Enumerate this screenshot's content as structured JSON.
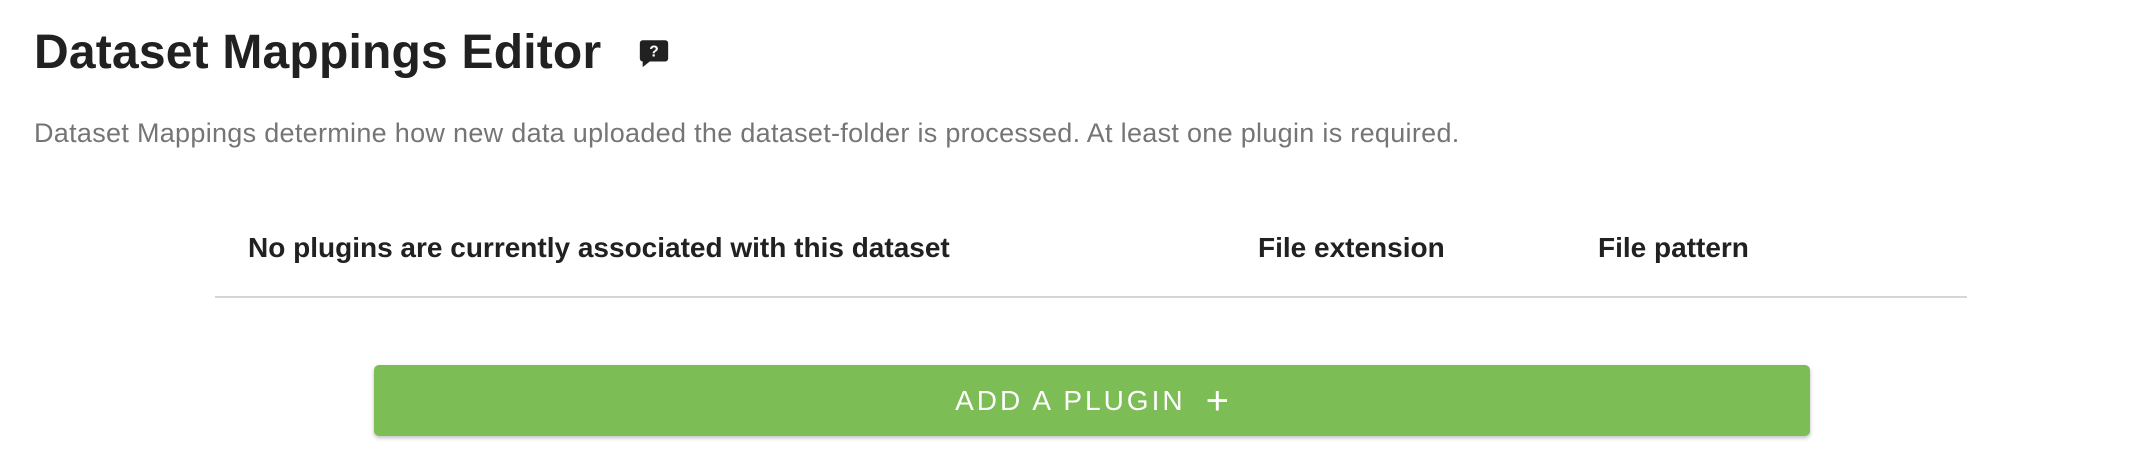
{
  "header": {
    "title": "Dataset Mappings Editor",
    "help_icon": "help-comment-icon"
  },
  "description": "Dataset Mappings determine how new data uploaded the dataset-folder is processed. At least one plugin is required.",
  "table": {
    "columns": [
      "No plugins are currently associated with this dataset",
      "File extension",
      "File pattern"
    ]
  },
  "add_button": {
    "label": "ADD A PLUGIN",
    "icon": "+",
    "color": "#7cbd55"
  }
}
